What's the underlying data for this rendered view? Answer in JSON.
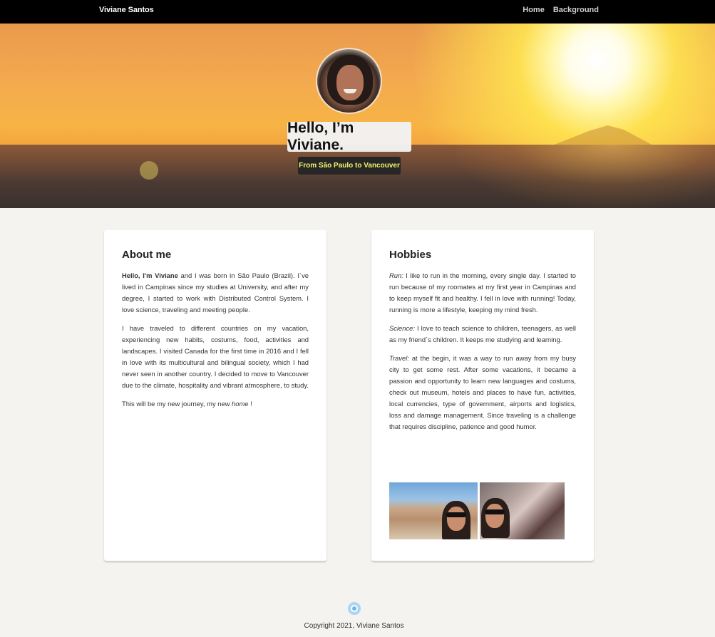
{
  "navbar": {
    "brand": "Viviane Santos",
    "links": [
      "Home",
      "Background"
    ]
  },
  "hero": {
    "title": "Hello, I’m Viviane.",
    "subtitle": "From São Paulo to Vancouver"
  },
  "about": {
    "heading": "About me",
    "intro_bold": "Hello, I'm Viviane",
    "intro_rest": " and I was born in São Paulo (Brazil). I´ve lived in Campinas since my studies at University, and after my degree, I started to work with Distributed Control System. I love science, traveling and meeting people.",
    "p2": "I have traveled to different countries on my vacation, experiencing new habits, costums, food, activities and landscapes. I visited Canada for the first time in 2016 and I fell in love with its multicultural and bilingual society, which I had never seen in another country. I decided to move to Vancouver due to the climate, hospitality and vibrant atmosphere, to study.",
    "p3_start": "This will be my new journey, my new ",
    "p3_em": "home",
    "p3_end": " !"
  },
  "hobbies": {
    "heading": "Hobbies",
    "run_label": "Run:",
    "run_text": " I like to run in the morning, every single day. I started to run because of my roomates at my first year in Campinas and to keep myself fit and healthy. I fell in love with running! Today, running is more a lifestyle, keeping my mind fresh.",
    "science_label": "Science:",
    "science_text": " I love to teach science to children, teenagers, as well as my friend´s children. It keeps me studying and learning.",
    "travel_label": "Travel:",
    "travel_text": " at the begin, it was a way to run away from my busy city to get some rest. After some vacations, it became a passion and opportunity to learn new languages and costums, check out museum, hotels and places to have fun, activities, local currencies, type of government, airports and logistics, loss and damage management. Since traveling is a challenge that requires discipline, patience and good humor."
  },
  "footer": {
    "copyright": "Copyright 2021, Viviane Santos"
  },
  "colors": {
    "navbar": "#000000",
    "page_bg": "#f4f3ef",
    "subtitle_text": "#f3f36a",
    "footer_icon": "#aad6f5"
  }
}
